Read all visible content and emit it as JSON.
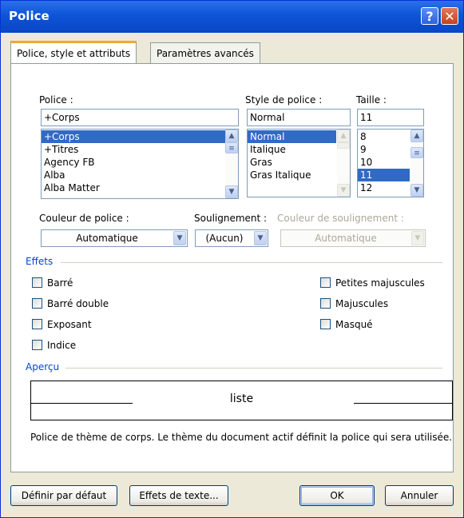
{
  "window": {
    "title": "Police",
    "help_label": "?",
    "close_label": "✕"
  },
  "tabs": [
    {
      "label": "Police, style et attributs",
      "active": true
    },
    {
      "label": "Paramètres avancés",
      "active": false
    }
  ],
  "font": {
    "label": "Police :",
    "value": "+Corps",
    "items": [
      "+Corps",
      "+Titres",
      "Agency FB",
      "Alba",
      "Alba Matter"
    ],
    "selected": "+Corps"
  },
  "style": {
    "label": "Style de police :",
    "value": "Normal",
    "items": [
      "Normal",
      "Italique",
      "Gras",
      "Gras Italique"
    ],
    "selected": "Normal"
  },
  "size": {
    "label": "Taille :",
    "value": "11",
    "items": [
      "8",
      "9",
      "10",
      "11",
      "12"
    ],
    "selected": "11"
  },
  "font_color": {
    "label": "Couleur de police :",
    "value": "Automatique"
  },
  "underline": {
    "label": "Soulignement :",
    "value": "(Aucun)"
  },
  "underline_color": {
    "label": "Couleur de soulignement :",
    "value": "Automatique"
  },
  "effects": {
    "title": "Effets",
    "left": [
      {
        "label": "Barré",
        "checked": false
      },
      {
        "label": "Barré double",
        "checked": false
      },
      {
        "label": "Exposant",
        "checked": false
      },
      {
        "label": "Indice",
        "checked": false
      }
    ],
    "right": [
      {
        "label": "Petites majuscules",
        "checked": false
      },
      {
        "label": "Majuscules",
        "checked": false
      },
      {
        "label": "Masqué",
        "checked": false
      }
    ]
  },
  "preview": {
    "title": "Aperçu",
    "sample": "liste",
    "description": "Police de thème de corps. Le thème du document actif définit la police qui sera utilisée."
  },
  "buttons": {
    "set_default": "Définir par défaut",
    "text_effects": "Effets de texte...",
    "ok": "OK",
    "cancel": "Annuler"
  },
  "colors": {
    "title_bar": "#0d54d8",
    "selection": "#316ac5",
    "group_title": "#0046d5",
    "tab_accent": "#f4a638"
  }
}
